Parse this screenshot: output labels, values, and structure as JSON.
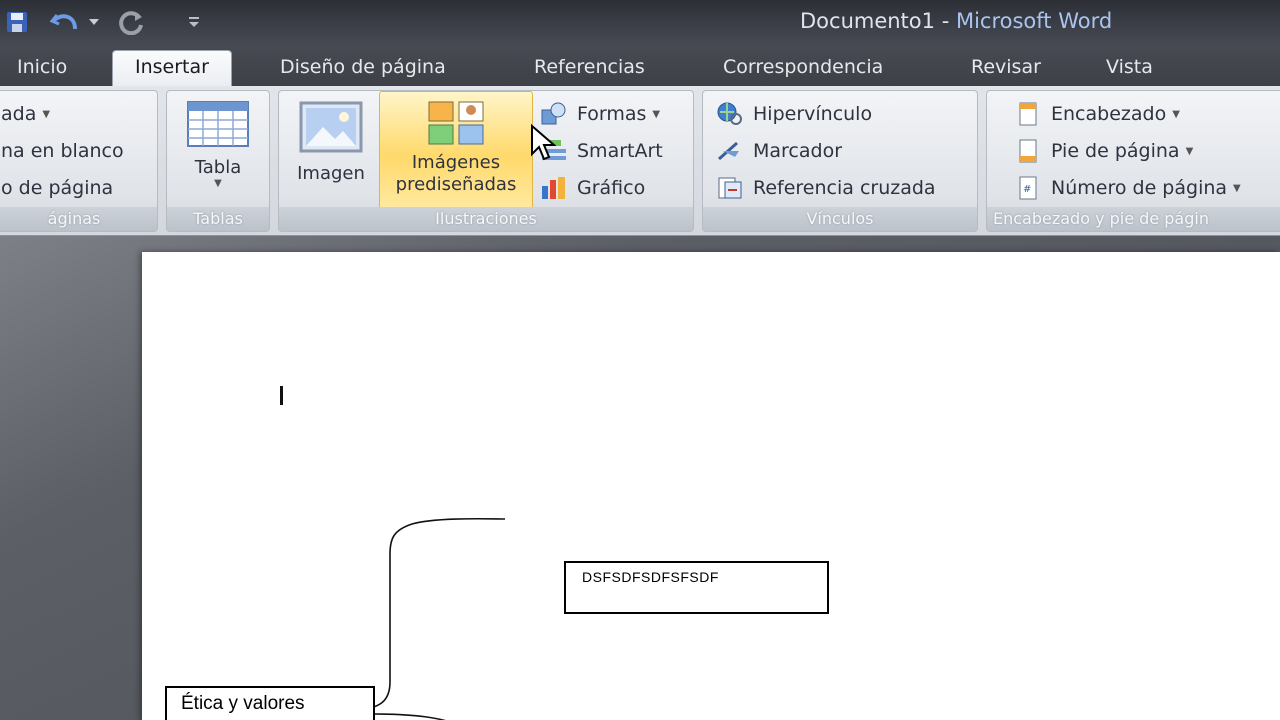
{
  "window": {
    "document_name": "Documento1",
    "separator": " - ",
    "app_name": "Microsoft Word"
  },
  "tabs": [
    {
      "label": "Inicio",
      "active": false
    },
    {
      "label": "Insertar",
      "active": true
    },
    {
      "label": "Diseño de página",
      "active": false
    },
    {
      "label": "Referencias",
      "active": false
    },
    {
      "label": "Correspondencia",
      "active": false
    },
    {
      "label": "Revisar",
      "active": false
    },
    {
      "label": "Vista",
      "active": false
    }
  ],
  "ribbon": {
    "paginas": {
      "items": [
        "ada",
        "na en blanco",
        "o de página"
      ],
      "label": "áginas"
    },
    "tablas": {
      "tabla": "Tabla",
      "label": "Tablas"
    },
    "ilustraciones": {
      "imagen": "Imagen",
      "imagenes_line1": "Imágenes",
      "imagenes_line2": "prediseñadas",
      "formas": "Formas",
      "smartart": "SmartArt",
      "grafico": "Gráfico",
      "label": "Ilustraciones"
    },
    "vinculos": {
      "hipervinculo": "Hipervínculo",
      "marcador": "Marcador",
      "referencia": "Referencia cruzada",
      "label": "Vínculos"
    },
    "encabezado": {
      "encabezado": "Encabezado",
      "pie": "Pie de página",
      "numero": "Número de página",
      "label": "Encabezado y pie de págin"
    }
  },
  "document": {
    "box1_text": "DSFSDFSDFSFSDF",
    "box2_text": "Ética y valores"
  },
  "colors": {
    "highlight": "#ffd96b",
    "title_app": "#a9c4ee"
  }
}
